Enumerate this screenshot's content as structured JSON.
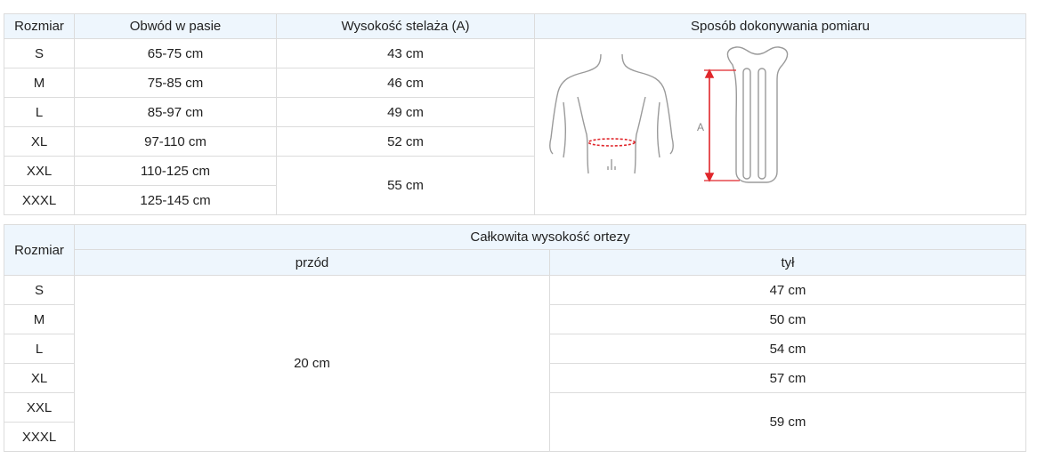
{
  "sizes_table": {
    "headers": {
      "size": "Rozmiar",
      "waist": "Obwód w pasie",
      "frame_height": "Wysokość stelaża (A)",
      "method": "Sposób dokonywania pomiaru"
    },
    "rows": [
      {
        "size": "S",
        "waist": "65-75 cm",
        "frame_height": "43 cm"
      },
      {
        "size": "M",
        "waist": "75-85 cm",
        "frame_height": "46 cm"
      },
      {
        "size": "L",
        "waist": "85-97 cm",
        "frame_height": "49 cm"
      },
      {
        "size": "XL",
        "waist": "97-110 cm",
        "frame_height": "52 cm"
      },
      {
        "size": "XXL",
        "waist": "110-125 cm",
        "frame_height": "55 cm"
      },
      {
        "size": "XXXL",
        "waist": "125-145 cm"
      }
    ],
    "illustration": {
      "dimension_label": "A",
      "measure_color": "#e0262b",
      "line_color": "#9a9a9a"
    }
  },
  "height_table": {
    "headers": {
      "size": "Rozmiar",
      "total": "Całkowita wysokość ortezy",
      "front": "przód",
      "back": "tył"
    },
    "front_value": "20 cm",
    "rows": [
      {
        "size": "S",
        "back": "47 cm"
      },
      {
        "size": "M",
        "back": "50 cm"
      },
      {
        "size": "L",
        "back": "54 cm"
      },
      {
        "size": "XL",
        "back": "57 cm"
      },
      {
        "size": "XXL",
        "back": "59 cm"
      },
      {
        "size": "XXXL"
      }
    ]
  },
  "colors": {
    "header_bg": "#eef6fd",
    "border": "#dcdcdc"
  }
}
